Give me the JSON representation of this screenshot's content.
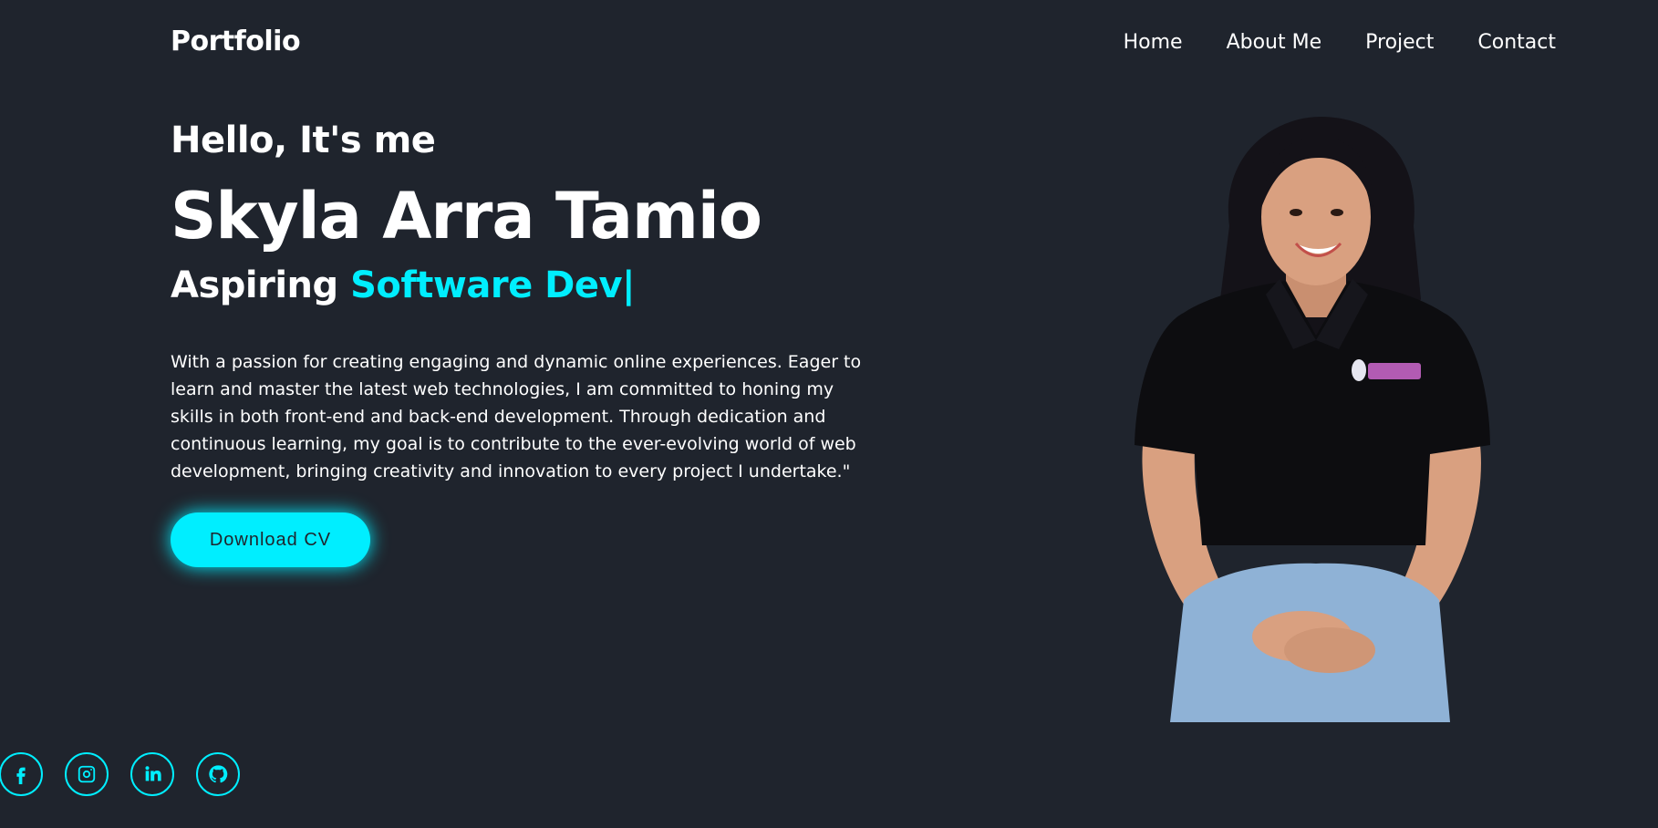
{
  "header": {
    "logo": "Portfolio",
    "nav": [
      "Home",
      "About Me",
      "Project",
      "Contact"
    ]
  },
  "hero": {
    "greeting": "Hello, It's me",
    "name": "Skyla Arra Tamio",
    "role_prefix": "Aspiring",
    "role_highlight": "Software Dev",
    "caret": "|",
    "description": "With a passion for creating engaging and dynamic online experiences. Eager to learn and master the latest web technologies, I am committed to honing my skills in both front-end and back-end development. Through dedication and continuous learning, my goal is to contribute to the ever-evolving world of web development, bringing creativity and innovation to every project I undertake.\"",
    "cv_button": "Download CV"
  },
  "social": {
    "icons": [
      "facebook-icon",
      "instagram-icon",
      "linkedin-icon",
      "github-icon"
    ]
  },
  "colors": {
    "background": "#1f242d",
    "accent": "#00eeff",
    "text": "#ffffff"
  }
}
